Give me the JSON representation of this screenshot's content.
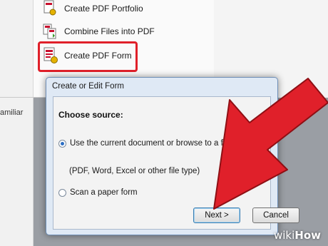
{
  "background": {
    "menu_items": [
      {
        "label": "Create PDF Portfolio",
        "icon": "pdf-portfolio-icon"
      },
      {
        "label": "Combine Files into PDF",
        "icon": "combine-files-icon"
      },
      {
        "label": "Create PDF Form",
        "icon": "pdf-form-icon"
      }
    ],
    "left_fragment": "amiliar"
  },
  "dialog": {
    "title": "Create or Edit Form",
    "section_label": "Choose source:",
    "options": [
      {
        "label": "Use the current document or browse to a file",
        "selected": true
      },
      {
        "label": "Scan a paper form",
        "selected": false
      }
    ],
    "hint": "(PDF, Word, Excel or other file type)",
    "buttons": {
      "next": "Next >",
      "cancel": "Cancel"
    }
  },
  "watermark": {
    "prefix": "wiki",
    "suffix": "How"
  },
  "colors": {
    "highlight": "#e0202a",
    "arrow": "#e0202a",
    "dialog_frame": "#dfe9f5"
  }
}
